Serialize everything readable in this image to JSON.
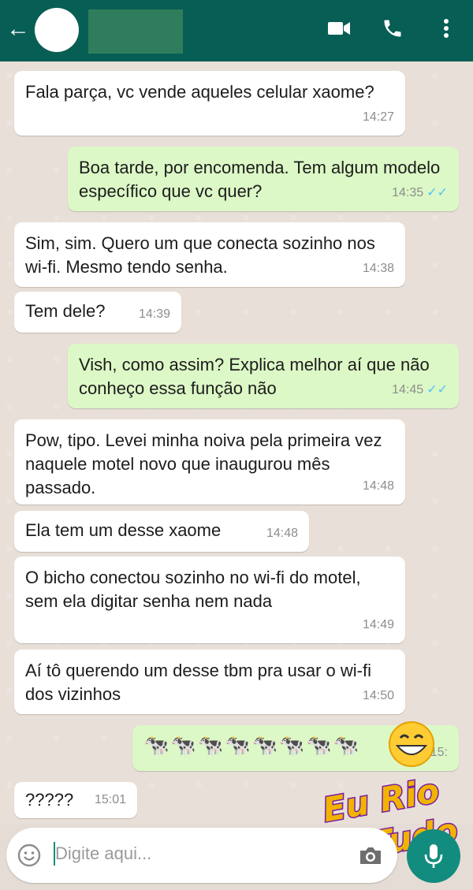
{
  "header": {
    "contact_name": "",
    "icons": {
      "back": "arrow-left-icon",
      "video": "video-call-icon",
      "call": "phone-icon",
      "menu": "more-vert-icon"
    },
    "colors": {
      "bar": "#075e54"
    }
  },
  "messages": [
    {
      "dir": "in",
      "text": "Fala parça, vc vende aqueles celular xaome?",
      "time": "14:27"
    },
    {
      "dir": "out",
      "text": "Boa tarde, por encomenda. Tem algum modelo específico que vc quer?",
      "time": "14:35",
      "ticks": "✓✓"
    },
    {
      "dir": "in",
      "text": "Sim, sim. Quero um que conecta sozinho nos wi-fi. Mesmo tendo senha.",
      "time": "14:38"
    },
    {
      "dir": "in",
      "text": "Tem dele?",
      "time": "14:39"
    },
    {
      "dir": "out",
      "text": "Vish, como assim? Explica melhor aí que não conheço essa função não",
      "time": "14:45",
      "ticks": "✓✓"
    },
    {
      "dir": "in",
      "text": "Pow, tipo. Levei minha noiva pela primeira vez naquele motel novo que inaugurou mês passado.",
      "time": "14:48"
    },
    {
      "dir": "in",
      "text": "Ela tem um desse xaome",
      "time": "14:48"
    },
    {
      "dir": "in",
      "text": "O bicho conectou sozinho no wi-fi do motel, sem ela digitar senha nem nada",
      "time": "14:49"
    },
    {
      "dir": "in",
      "text": "Aí tô querendo um desse tbm pra usar o wi-fi dos vizinhos",
      "time": "14:50"
    },
    {
      "dir": "out",
      "text": "🐄🐄🐄🐄🐄🐄🐄🐄",
      "time": "15:",
      "ticks": ""
    },
    {
      "dir": "in",
      "text": "?????",
      "time": "15:01"
    }
  ],
  "input": {
    "placeholder": "Digite aqui..."
  },
  "watermark": {
    "line1": "Eu Rio",
    "line2": "De Tudo",
    "emoji": "😁"
  },
  "colors": {
    "incoming": "#ffffff",
    "outgoing": "#dcf8c6",
    "accent": "#128c7e",
    "ticks": "#4fc3f7"
  }
}
